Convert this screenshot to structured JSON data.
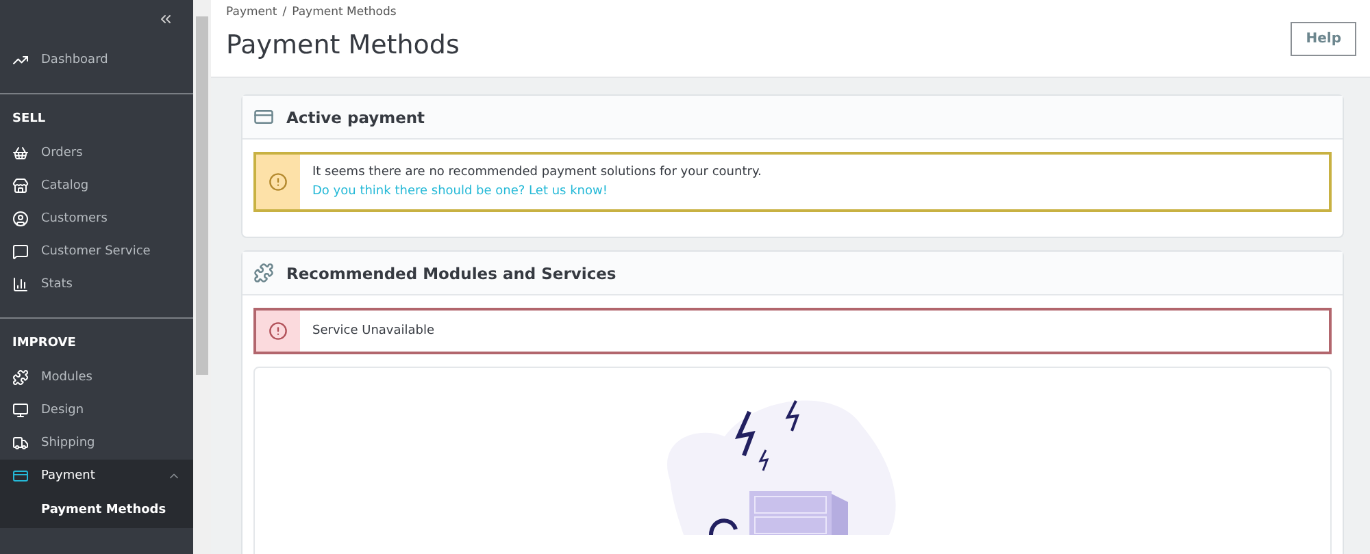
{
  "sidebar": {
    "sections": [
      {
        "items": [
          {
            "label": "Dashboard",
            "selected": false
          }
        ]
      },
      {
        "title": "SELL",
        "items": [
          {
            "label": "Orders",
            "selected": false
          },
          {
            "label": "Catalog",
            "selected": false
          },
          {
            "label": "Customers",
            "selected": false
          },
          {
            "label": "Customer Service",
            "selected": false
          },
          {
            "label": "Stats",
            "selected": false
          }
        ]
      },
      {
        "title": "IMPROVE",
        "items": [
          {
            "label": "Modules",
            "selected": false
          },
          {
            "label": "Design",
            "selected": false
          },
          {
            "label": "Shipping",
            "selected": false
          },
          {
            "label": "Payment",
            "selected": true,
            "expanded": true,
            "children": [
              {
                "label": "Payment Methods",
                "selected": true
              }
            ]
          }
        ]
      }
    ]
  },
  "breadcrumb": [
    {
      "label": "Payment",
      "separator": "/"
    },
    {
      "label": "Payment Methods"
    }
  ],
  "page_title": "Payment Methods",
  "help_button": "Help",
  "cards": [
    {
      "title": "Active payment",
      "alert": {
        "kind": "warning",
        "text": "It seems there are no recommended payment solutions for your country.",
        "link": "Do you think there should be one? Let us know!"
      }
    },
    {
      "title": "Recommended Modules and Services",
      "alert": {
        "kind": "error",
        "text": "Service Unavailable"
      },
      "illustration": true
    }
  ]
}
